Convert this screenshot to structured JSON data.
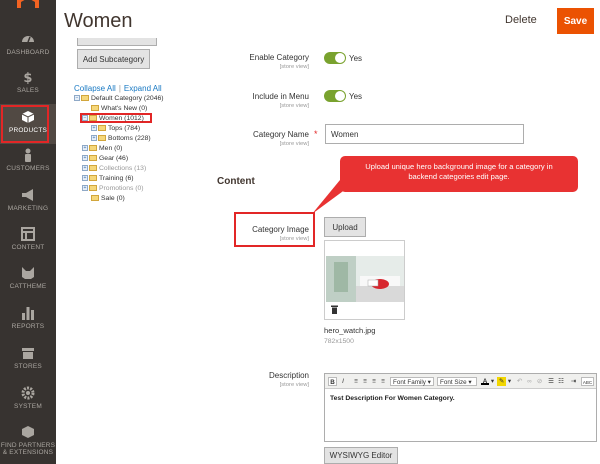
{
  "sidebar": {
    "items": [
      {
        "label": "DASHBOARD",
        "icon": "dashboard-icon"
      },
      {
        "label": "SALES",
        "icon": "dollar-icon"
      },
      {
        "label": "PRODUCTS",
        "icon": "cube-icon",
        "active": true
      },
      {
        "label": "CUSTOMERS",
        "icon": "person-icon"
      },
      {
        "label": "MARKETING",
        "icon": "megaphone-icon"
      },
      {
        "label": "CONTENT",
        "icon": "layout-icon"
      },
      {
        "label": "CATTHEME",
        "icon": "cat-icon"
      },
      {
        "label": "REPORTS",
        "icon": "bar-chart-icon"
      },
      {
        "label": "STORES",
        "icon": "store-icon"
      },
      {
        "label": "SYSTEM",
        "icon": "gear-icon"
      },
      {
        "label": "FIND PARTNERS",
        "label2": "& EXTENSIONS",
        "icon": "extensions-icon"
      }
    ]
  },
  "header": {
    "title": "Women",
    "delete_label": "Delete",
    "save_label": "Save"
  },
  "tree": {
    "add_subcategory_label": "Add Subcategory",
    "collapse_all": "Collapse All",
    "separator": "|",
    "expand_all": "Expand All",
    "nodes": [
      {
        "label": "Default Category (2046)"
      },
      {
        "label": "What's New (0)"
      },
      {
        "label": "Women (1012)",
        "selected": true
      },
      {
        "label": "Tops (784)"
      },
      {
        "label": "Bottoms (228)"
      },
      {
        "label": "Men (0)"
      },
      {
        "label": "Gear (46)"
      },
      {
        "label": "Collections (13)",
        "disabled": true
      },
      {
        "label": "Training (6)"
      },
      {
        "label": "Promotions (0)",
        "disabled": true
      },
      {
        "label": "Sale (0)"
      }
    ]
  },
  "form": {
    "scope_label": "[store view]",
    "enable_category": {
      "label": "Enable Category",
      "value": "Yes"
    },
    "include_in_menu": {
      "label": "Include in Menu",
      "value": "Yes"
    },
    "category_name": {
      "label": "Category Name",
      "required_mark": "*",
      "value": "Women"
    },
    "content_section": "Content",
    "category_image": {
      "label": "Category Image",
      "upload_label": "Upload",
      "file_name": "hero_watch.jpg",
      "file_size": "782x1500"
    },
    "description": {
      "label": "Description",
      "value": "Test Description For Women Category.",
      "wysiwyg_label": "WYSIWYG Editor"
    }
  },
  "editor_toolbar": {
    "bold": "B",
    "italic": "I",
    "font_family": "Font Family",
    "font_size": "Font Size",
    "font_color": "A",
    "abc": "ABC"
  },
  "callout": {
    "text": "Upload unique hero background image for a category in backend categories edit page."
  },
  "colors": {
    "accent": "#eb5202",
    "sidebar": "#373330",
    "toggle_on": "#79a22e",
    "highlight": "#e22626",
    "link": "#1979c3"
  }
}
